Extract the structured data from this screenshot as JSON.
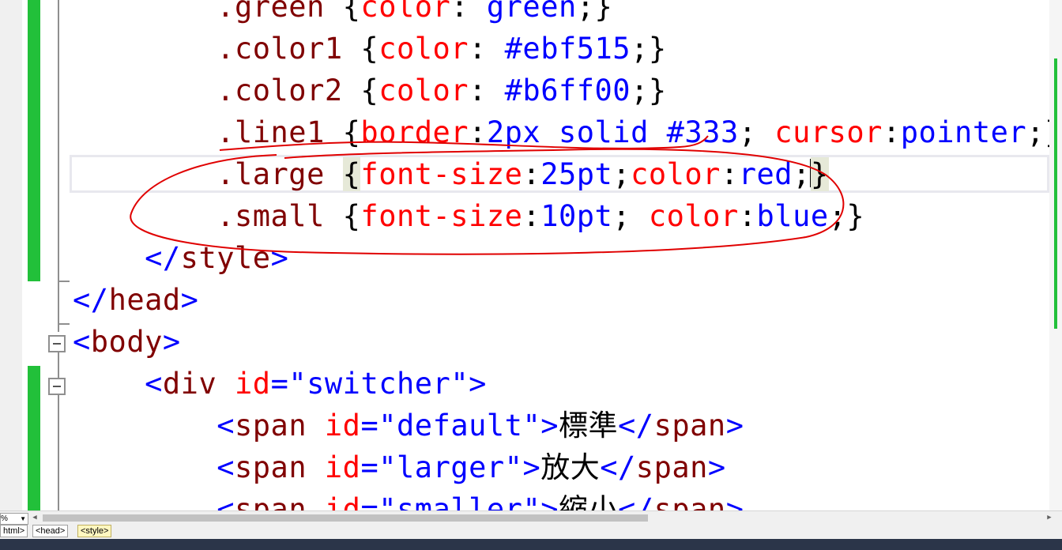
{
  "editor": {
    "lines": [
      {
        "segments": [
          {
            "t": "        .green ",
            "c": "sel"
          },
          {
            "t": "{",
            "c": "txt"
          },
          {
            "t": "color",
            "c": "prop"
          },
          {
            "t": ": ",
            "c": "txt"
          },
          {
            "t": "green",
            "c": "val"
          },
          {
            "t": ";}",
            "c": "txt"
          }
        ]
      },
      {
        "segments": [
          {
            "t": "        .color1 ",
            "c": "sel"
          },
          {
            "t": "{",
            "c": "txt"
          },
          {
            "t": "color",
            "c": "prop"
          },
          {
            "t": ": ",
            "c": "txt"
          },
          {
            "t": "#ebf515",
            "c": "val"
          },
          {
            "t": ";}",
            "c": "txt"
          }
        ]
      },
      {
        "segments": [
          {
            "t": "        .color2 ",
            "c": "sel"
          },
          {
            "t": "{",
            "c": "txt"
          },
          {
            "t": "color",
            "c": "prop"
          },
          {
            "t": ": ",
            "c": "txt"
          },
          {
            "t": "#b6ff00",
            "c": "val"
          },
          {
            "t": ";}",
            "c": "txt"
          }
        ]
      },
      {
        "segments": [
          {
            "t": "        .line1 ",
            "c": "sel"
          },
          {
            "t": "{",
            "c": "txt"
          },
          {
            "t": "border",
            "c": "prop"
          },
          {
            "t": ":",
            "c": "txt"
          },
          {
            "t": "2px solid #333",
            "c": "val"
          },
          {
            "t": "; ",
            "c": "txt"
          },
          {
            "t": "cursor",
            "c": "prop"
          },
          {
            "t": ":",
            "c": "txt"
          },
          {
            "t": "pointer",
            "c": "val"
          },
          {
            "t": ";}",
            "c": "txt"
          }
        ]
      },
      {
        "segments": [
          {
            "t": "        .large ",
            "c": "sel"
          },
          {
            "t": "{",
            "c": "txt hl"
          },
          {
            "t": "font-size",
            "c": "prop"
          },
          {
            "t": ":",
            "c": "txt"
          },
          {
            "t": "25pt",
            "c": "val"
          },
          {
            "t": ";",
            "c": "txt"
          },
          {
            "t": "color",
            "c": "prop"
          },
          {
            "t": ":",
            "c": "txt"
          },
          {
            "t": "red",
            "c": "val"
          },
          {
            "t": ";",
            "c": "txt"
          },
          {
            "t": "|",
            "c": "caret"
          },
          {
            "t": "}",
            "c": "txt hl"
          }
        ]
      },
      {
        "segments": [
          {
            "t": "        .small ",
            "c": "sel"
          },
          {
            "t": "{",
            "c": "txt"
          },
          {
            "t": "font-size",
            "c": "prop"
          },
          {
            "t": ":",
            "c": "txt"
          },
          {
            "t": "10pt",
            "c": "val"
          },
          {
            "t": "; ",
            "c": "txt"
          },
          {
            "t": "color",
            "c": "prop"
          },
          {
            "t": ":",
            "c": "txt"
          },
          {
            "t": "blue",
            "c": "val"
          },
          {
            "t": ";}",
            "c": "txt"
          }
        ]
      },
      {
        "segments": [
          {
            "t": "    ",
            "c": "txt"
          },
          {
            "t": "</",
            "c": "br"
          },
          {
            "t": "style",
            "c": "tag"
          },
          {
            "t": ">",
            "c": "br"
          }
        ]
      },
      {
        "segments": [
          {
            "t": "</",
            "c": "br"
          },
          {
            "t": "head",
            "c": "tag"
          },
          {
            "t": ">",
            "c": "br"
          }
        ]
      },
      {
        "segments": [
          {
            "t": "<",
            "c": "br"
          },
          {
            "t": "body",
            "c": "tag"
          },
          {
            "t": ">",
            "c": "br"
          }
        ]
      },
      {
        "segments": [
          {
            "t": "    ",
            "c": "txt"
          },
          {
            "t": "<",
            "c": "br"
          },
          {
            "t": "div ",
            "c": "tag"
          },
          {
            "t": "id",
            "c": "attr"
          },
          {
            "t": "=\"",
            "c": "br"
          },
          {
            "t": "switcher",
            "c": "aval"
          },
          {
            "t": "\">",
            "c": "br"
          }
        ]
      },
      {
        "segments": [
          {
            "t": "        ",
            "c": "txt"
          },
          {
            "t": "<",
            "c": "br"
          },
          {
            "t": "span ",
            "c": "tag"
          },
          {
            "t": "id",
            "c": "attr"
          },
          {
            "t": "=\"",
            "c": "br"
          },
          {
            "t": "default",
            "c": "aval"
          },
          {
            "t": "\">",
            "c": "br"
          },
          {
            "t": "標準",
            "c": "txt"
          },
          {
            "t": "</",
            "c": "br"
          },
          {
            "t": "span",
            "c": "tag"
          },
          {
            "t": ">",
            "c": "br"
          }
        ]
      },
      {
        "segments": [
          {
            "t": "        ",
            "c": "txt"
          },
          {
            "t": "<",
            "c": "br"
          },
          {
            "t": "span ",
            "c": "tag"
          },
          {
            "t": "id",
            "c": "attr"
          },
          {
            "t": "=\"",
            "c": "br"
          },
          {
            "t": "larger",
            "c": "aval"
          },
          {
            "t": "\">",
            "c": "br"
          },
          {
            "t": "放大",
            "c": "txt"
          },
          {
            "t": "</",
            "c": "br"
          },
          {
            "t": "span",
            "c": "tag"
          },
          {
            "t": ">",
            "c": "br"
          }
        ]
      },
      {
        "segments": [
          {
            "t": "        ",
            "c": "txt"
          },
          {
            "t": "<",
            "c": "br"
          },
          {
            "t": "span ",
            "c": "tag"
          },
          {
            "t": "id",
            "c": "attr"
          },
          {
            "t": "=\"",
            "c": "br"
          },
          {
            "t": "smaller",
            "c": "aval"
          },
          {
            "t": "\">",
            "c": "br"
          },
          {
            "t": "縮小",
            "c": "txt"
          },
          {
            "t": "</",
            "c": "br"
          },
          {
            "t": "span",
            "c": "tag"
          },
          {
            "t": ">",
            "c": "br"
          }
        ]
      }
    ]
  },
  "status": {
    "zoom": "%",
    "breadcrumbs": [
      "html>",
      "<head>",
      "<style>"
    ]
  },
  "colors": {
    "change_bar": "#22c03a",
    "annotation": "#e00000",
    "status_bar": "#2b3549"
  }
}
